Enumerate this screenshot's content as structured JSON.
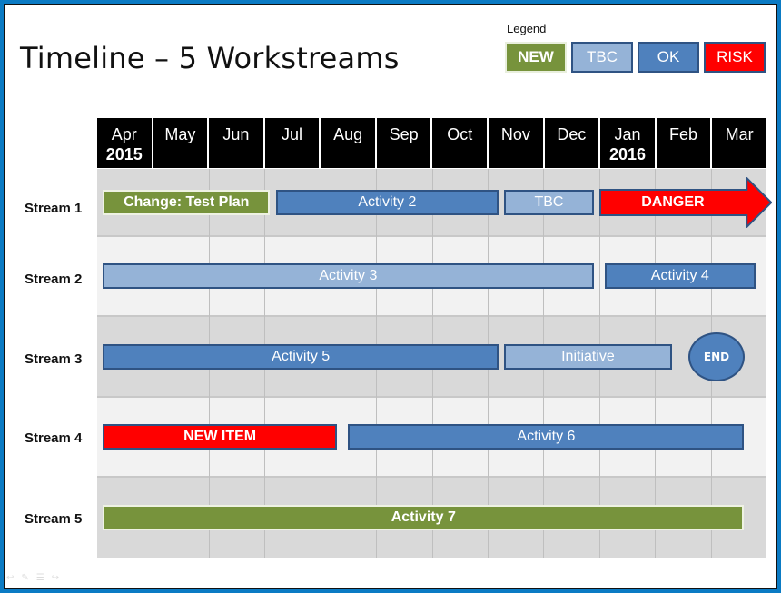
{
  "title": "Timeline – 5 Workstreams",
  "legend": {
    "label": "Legend",
    "items": [
      {
        "key": "new",
        "label": "NEW",
        "color": "#77933c"
      },
      {
        "key": "tbc",
        "label": "TBC",
        "color": "#95b3d7"
      },
      {
        "key": "ok",
        "label": "OK",
        "color": "#4f81bd"
      },
      {
        "key": "risk",
        "label": "RISK",
        "color": "#ff0000"
      }
    ]
  },
  "months": [
    {
      "label": "Apr",
      "year": "2015"
    },
    {
      "label": "May",
      "year": ""
    },
    {
      "label": "Jun",
      "year": ""
    },
    {
      "label": "Jul",
      "year": ""
    },
    {
      "label": "Aug",
      "year": ""
    },
    {
      "label": "Sep",
      "year": ""
    },
    {
      "label": "Oct",
      "year": ""
    },
    {
      "label": "Nov",
      "year": ""
    },
    {
      "label": "Dec",
      "year": ""
    },
    {
      "label": "Jan",
      "year": "2016"
    },
    {
      "label": "Feb",
      "year": ""
    },
    {
      "label": "Mar",
      "year": ""
    }
  ],
  "streams": [
    {
      "label": "Stream 1"
    },
    {
      "label": "Stream 2"
    },
    {
      "label": "Stream 3"
    },
    {
      "label": "Stream 4"
    },
    {
      "label": "Stream 5"
    }
  ],
  "activities": [
    {
      "stream": 0,
      "label": "Change: Test Plan",
      "status": "new",
      "start_month": 0.1,
      "end_month": 3.1
    },
    {
      "stream": 0,
      "label": "Activity 2",
      "status": "ok",
      "start_month": 3.2,
      "end_month": 7.2
    },
    {
      "stream": 0,
      "label": "TBC",
      "status": "tbc",
      "start_month": 7.3,
      "end_month": 8.9
    },
    {
      "stream": 0,
      "label": "DANGER",
      "status": "risk",
      "shape": "arrow",
      "start_month": 9.0,
      "end_month": 12.0
    },
    {
      "stream": 1,
      "label": "Activity 3",
      "status": "tbc",
      "start_month": 0.1,
      "end_month": 8.9
    },
    {
      "stream": 1,
      "label": "Activity 4",
      "status": "ok",
      "start_month": 9.1,
      "end_month": 11.8
    },
    {
      "stream": 2,
      "label": "Activity 5",
      "status": "ok",
      "start_month": 0.1,
      "end_month": 7.2
    },
    {
      "stream": 2,
      "label": "Initiative",
      "status": "tbc",
      "start_month": 7.3,
      "end_month": 10.3
    },
    {
      "stream": 2,
      "label": "END",
      "status": "ok",
      "shape": "circle",
      "start_month": 10.6,
      "end_month": 11.6
    },
    {
      "stream": 3,
      "label": "NEW ITEM",
      "status": "risk",
      "start_month": 0.1,
      "end_month": 4.3
    },
    {
      "stream": 3,
      "label": "Activity 6",
      "status": "ok",
      "start_month": 4.5,
      "end_month": 11.6
    },
    {
      "stream": 4,
      "label": "Activity 7",
      "status": "new",
      "start_month": 0.1,
      "end_month": 11.6
    }
  ]
}
